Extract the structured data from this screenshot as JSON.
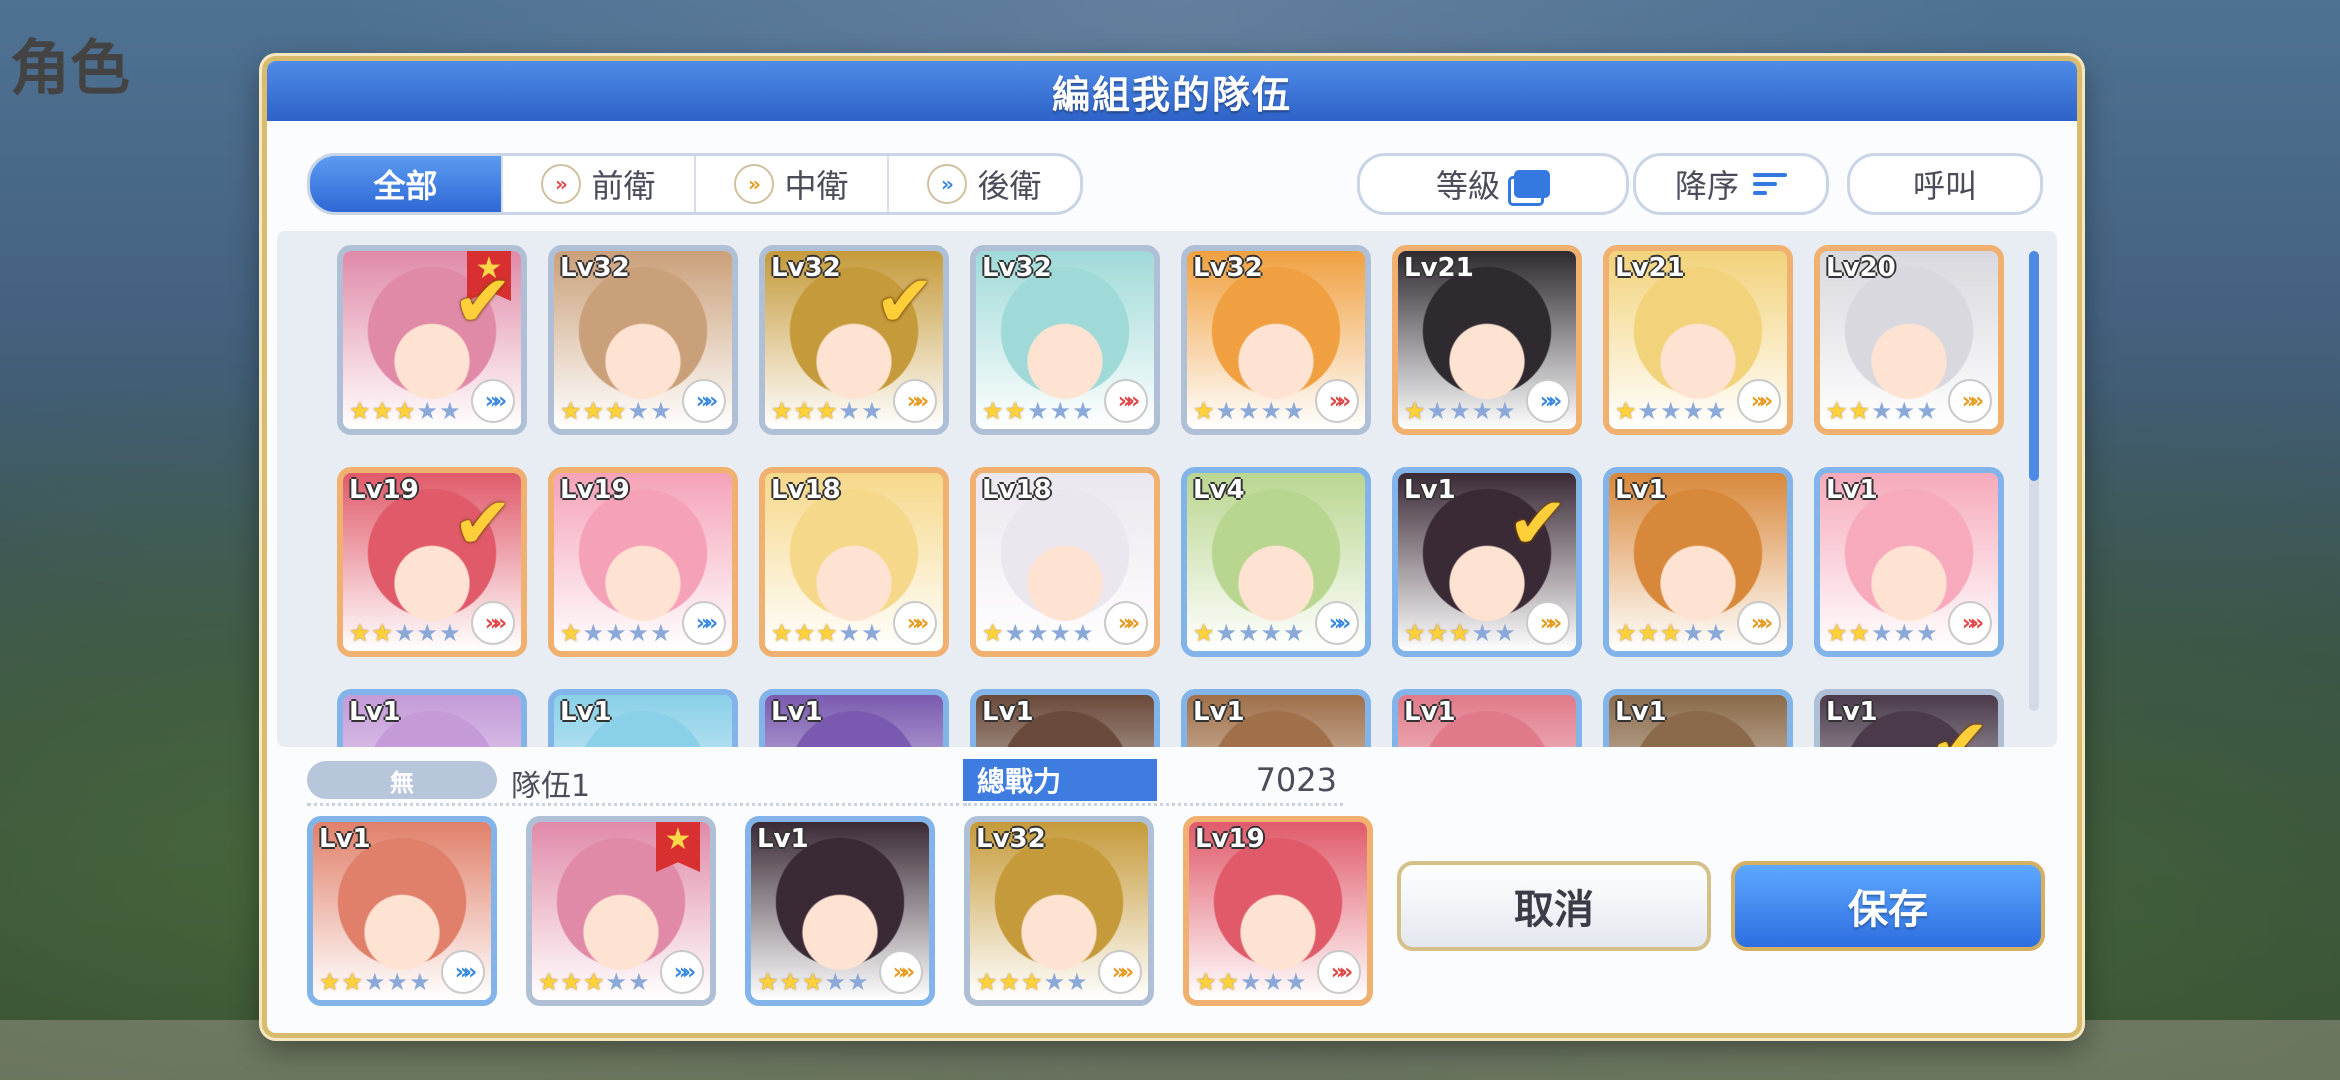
{
  "background": {
    "screen_title": "角色"
  },
  "dialog": {
    "title": "編組我的隊伍"
  },
  "filters": {
    "tabs": [
      {
        "label": "全部",
        "active": true,
        "role": ""
      },
      {
        "label": "前衛",
        "active": false,
        "role": "front"
      },
      {
        "label": "中衛",
        "active": false,
        "role": "mid"
      },
      {
        "label": "後衛",
        "active": false,
        "role": "back"
      }
    ],
    "sort_field": "等級",
    "sort_order": "降序",
    "call": "呼叫"
  },
  "roster": [
    [
      {
        "level": "",
        "stars": 3,
        "max_stars": 5,
        "role": "back",
        "selected": true,
        "leader": true,
        "frame": "r3",
        "color": "#e08aa8"
      },
      {
        "level": "Lv32",
        "stars": 3,
        "max_stars": 5,
        "role": "back",
        "selected": false,
        "leader": false,
        "frame": "r3",
        "color": "#caa07a"
      },
      {
        "level": "Lv32",
        "stars": 3,
        "max_stars": 5,
        "role": "mid",
        "selected": true,
        "leader": false,
        "frame": "r3",
        "color": "#c59a3a"
      },
      {
        "level": "Lv32",
        "stars": 2,
        "max_stars": 5,
        "role": "front",
        "selected": false,
        "leader": false,
        "frame": "r3",
        "color": "#9fdad8"
      },
      {
        "level": "Lv32",
        "stars": 1,
        "max_stars": 5,
        "role": "front",
        "selected": false,
        "leader": false,
        "frame": "r3",
        "color": "#f0a040"
      },
      {
        "level": "Lv21",
        "stars": 1,
        "max_stars": 5,
        "role": "back",
        "selected": false,
        "leader": false,
        "frame": "r2",
        "color": "#2e2a30"
      },
      {
        "level": "Lv21",
        "stars": 1,
        "max_stars": 5,
        "role": "mid",
        "selected": false,
        "leader": false,
        "frame": "r2",
        "color": "#f2d27a"
      },
      {
        "level": "Lv20",
        "stars": 2,
        "max_stars": 5,
        "role": "mid",
        "selected": false,
        "leader": false,
        "frame": "r2",
        "color": "#d8d8de"
      }
    ],
    [
      {
        "level": "Lv19",
        "stars": 2,
        "max_stars": 5,
        "role": "front",
        "selected": true,
        "leader": false,
        "frame": "r2",
        "color": "#e05a6a"
      },
      {
        "level": "Lv19",
        "stars": 1,
        "max_stars": 5,
        "role": "back",
        "selected": false,
        "leader": false,
        "frame": "r2",
        "color": "#f5a2b8"
      },
      {
        "level": "Lv18",
        "stars": 3,
        "max_stars": 5,
        "role": "mid",
        "selected": false,
        "leader": false,
        "frame": "r2",
        "color": "#f6d88a"
      },
      {
        "level": "Lv18",
        "stars": 1,
        "max_stars": 5,
        "role": "mid",
        "selected": false,
        "leader": false,
        "frame": "r2",
        "color": "#ece6ee"
      },
      {
        "level": "Lv4",
        "stars": 1,
        "max_stars": 5,
        "role": "back",
        "selected": false,
        "leader": false,
        "frame": "r1",
        "color": "#b9d690"
      },
      {
        "level": "Lv1",
        "stars": 3,
        "max_stars": 5,
        "role": "mid",
        "selected": true,
        "leader": false,
        "frame": "r1",
        "color": "#3a2a36"
      },
      {
        "level": "Lv1",
        "stars": 3,
        "max_stars": 5,
        "role": "mid",
        "selected": false,
        "leader": false,
        "frame": "r1",
        "color": "#d8883a"
      },
      {
        "level": "Lv1",
        "stars": 2,
        "max_stars": 5,
        "role": "front",
        "selected": false,
        "leader": false,
        "frame": "r1",
        "color": "#f6aabb"
      }
    ],
    [
      {
        "level": "Lv1",
        "stars": 0,
        "max_stars": 5,
        "role": "",
        "selected": false,
        "leader": false,
        "frame": "r1",
        "color": "#c49ad8"
      },
      {
        "level": "Lv1",
        "stars": 0,
        "max_stars": 5,
        "role": "",
        "selected": false,
        "leader": false,
        "frame": "r1",
        "color": "#8ad0e8"
      },
      {
        "level": "Lv1",
        "stars": 0,
        "max_stars": 5,
        "role": "",
        "selected": false,
        "leader": false,
        "frame": "r1",
        "color": "#7a5ab0"
      },
      {
        "level": "Lv1",
        "stars": 0,
        "max_stars": 5,
        "role": "",
        "selected": false,
        "leader": false,
        "frame": "r1",
        "color": "#6a4a3a"
      },
      {
        "level": "Lv1",
        "stars": 0,
        "max_stars": 5,
        "role": "",
        "selected": false,
        "leader": false,
        "frame": "r1",
        "color": "#a0704a"
      },
      {
        "level": "Lv1",
        "stars": 0,
        "max_stars": 5,
        "role": "",
        "selected": false,
        "leader": false,
        "frame": "r1",
        "color": "#e07a8a"
      },
      {
        "level": "Lv1",
        "stars": 0,
        "max_stars": 5,
        "role": "",
        "selected": false,
        "leader": false,
        "frame": "r1",
        "color": "#8a6a4a"
      },
      {
        "level": "Lv1",
        "stars": 0,
        "max_stars": 5,
        "role": "",
        "selected": true,
        "leader": false,
        "frame": "r3",
        "color": "#4a3a4a"
      }
    ]
  ],
  "team": {
    "tag": "無",
    "name": "隊伍1",
    "power_label": "總戰力",
    "power_value": "7023",
    "members": [
      {
        "level": "Lv1",
        "stars": 2,
        "max_stars": 5,
        "role": "back",
        "leader": false,
        "frame": "r1",
        "color": "#e0806a"
      },
      {
        "level": "",
        "stars": 3,
        "max_stars": 5,
        "role": "back",
        "leader": true,
        "frame": "r3",
        "color": "#e08aa8"
      },
      {
        "level": "Lv1",
        "stars": 3,
        "max_stars": 5,
        "role": "mid",
        "leader": false,
        "frame": "r1",
        "color": "#3a2a36"
      },
      {
        "level": "Lv32",
        "stars": 3,
        "max_stars": 5,
        "role": "mid",
        "leader": false,
        "frame": "r3",
        "color": "#c59a3a"
      },
      {
        "level": "Lv19",
        "stars": 2,
        "max_stars": 5,
        "role": "front",
        "leader": false,
        "frame": "r2",
        "color": "#e05a6a"
      }
    ]
  },
  "actions": {
    "cancel": "取消",
    "save": "保存"
  },
  "icons": {
    "leader": "star-icon",
    "selected": "check-icon",
    "sort_field": "stack-icon",
    "sort_order": "sort-lines-icon"
  }
}
